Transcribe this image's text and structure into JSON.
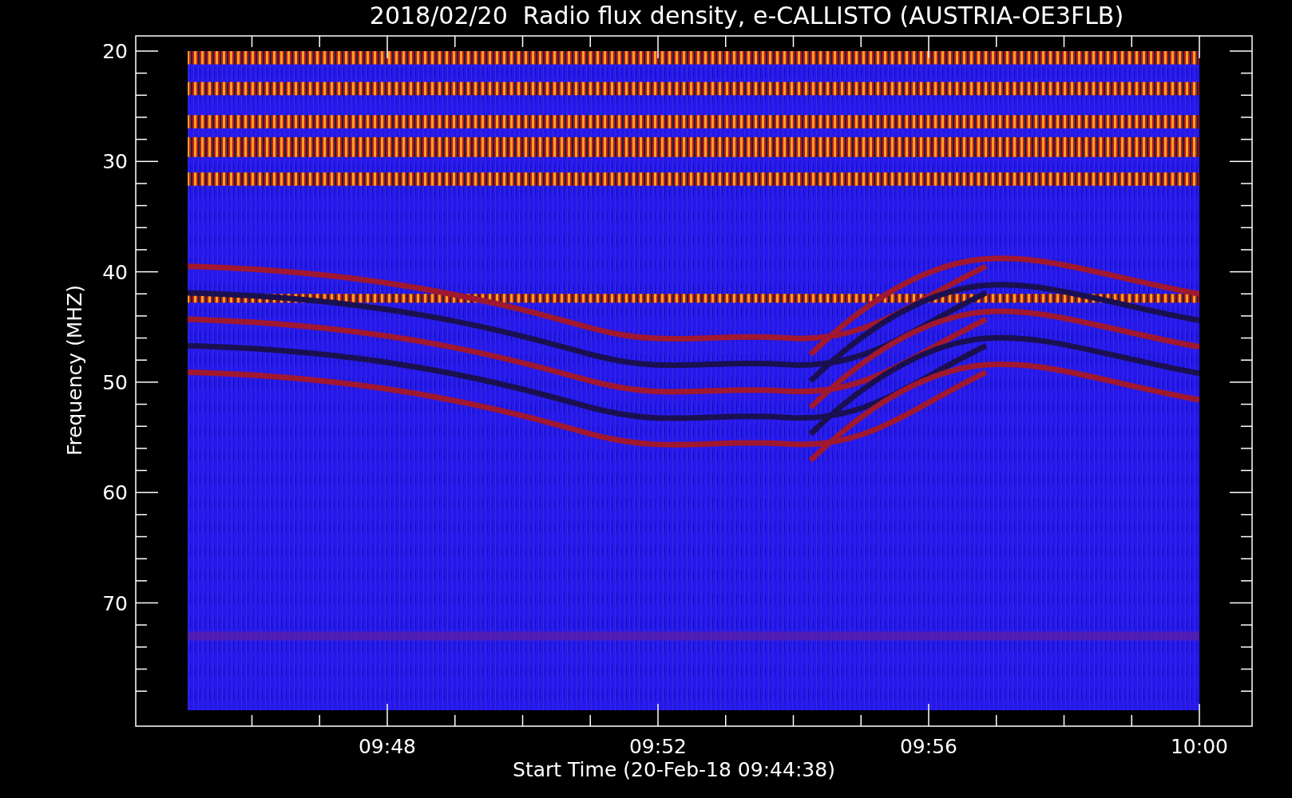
{
  "title": "2018/02/20  Radio flux density, e-CALLISTO (AUSTRIA-OE3FLB)",
  "y_axis": {
    "label": "Frequency (MHZ)",
    "ticks": [
      "20",
      "30",
      "40",
      "50",
      "60",
      "70"
    ]
  },
  "x_axis": {
    "label": "Start Time (20-Feb-18 09:44:38)",
    "ticks": [
      "09:48",
      "09:52",
      "09:56",
      "10:00"
    ]
  }
}
